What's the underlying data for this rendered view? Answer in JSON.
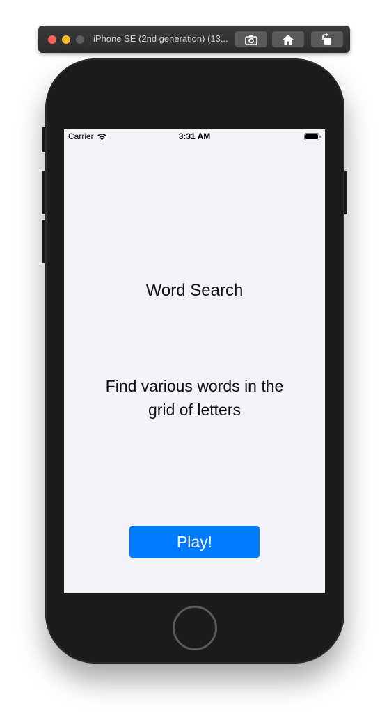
{
  "simulator": {
    "window_title": "iPhone SE (2nd generation) (13...",
    "buttons": {
      "screenshot_icon": "camera-icon",
      "home_icon": "home-icon",
      "rotate_icon": "rotate-icon"
    }
  },
  "status_bar": {
    "carrier": "Carrier",
    "time": "3:31 AM",
    "wifi_icon": "wifi-icon",
    "battery_icon": "battery-icon"
  },
  "app": {
    "title": "Word Search",
    "subtitle": "Find various words in the grid of letters",
    "play_label": "Play!"
  },
  "colors": {
    "accent": "#007aff",
    "screen_background": "#f2f2f7",
    "device_body": "#1b1b1c"
  }
}
